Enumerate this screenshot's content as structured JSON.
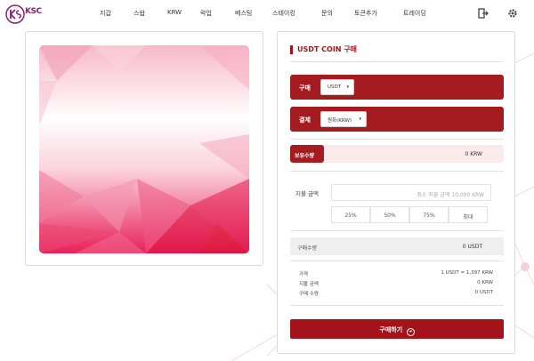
{
  "brand": {
    "logo_text": "KSC"
  },
  "nav": [
    {
      "label": "지갑"
    },
    {
      "label": "스왑"
    },
    {
      "label": "KRW"
    },
    {
      "label": "락업"
    },
    {
      "label": "베스팅"
    },
    {
      "label": "스테이킹"
    },
    {
      "label": "문의"
    },
    {
      "label": "토큰추가"
    },
    {
      "label": "트레이딩"
    }
  ],
  "icons": {
    "logout": "logout-icon",
    "settings": "gear-icon"
  },
  "purchase": {
    "title": "USDT COIN 구매",
    "buy_row": {
      "label": "구매",
      "selected": "USDT"
    },
    "pay_row": {
      "label": "결제",
      "selected": "원화(KRW)"
    },
    "balance": {
      "label": "보유수량",
      "value": "0 KRW"
    },
    "pay_amount": {
      "label": "지불 금액",
      "placeholder": "최소 지불 금액 10,000 KRW"
    },
    "percent_buttons": [
      "25%",
      "50%",
      "75%",
      "최대"
    ],
    "quantity": {
      "label": "구매수량",
      "value": "0 USDT"
    },
    "summary": [
      {
        "label": "가격",
        "value": "1 USDT = 1,397 KRW"
      },
      {
        "label": "지불 금액",
        "value": "0 KRW"
      },
      {
        "label": "구매 수량",
        "value": "0 USDT"
      }
    ],
    "buy_button": "구매하기"
  },
  "colors": {
    "accent": "#a31319",
    "brand": "#8e1d74",
    "balance_bg": "#fbeaea"
  }
}
